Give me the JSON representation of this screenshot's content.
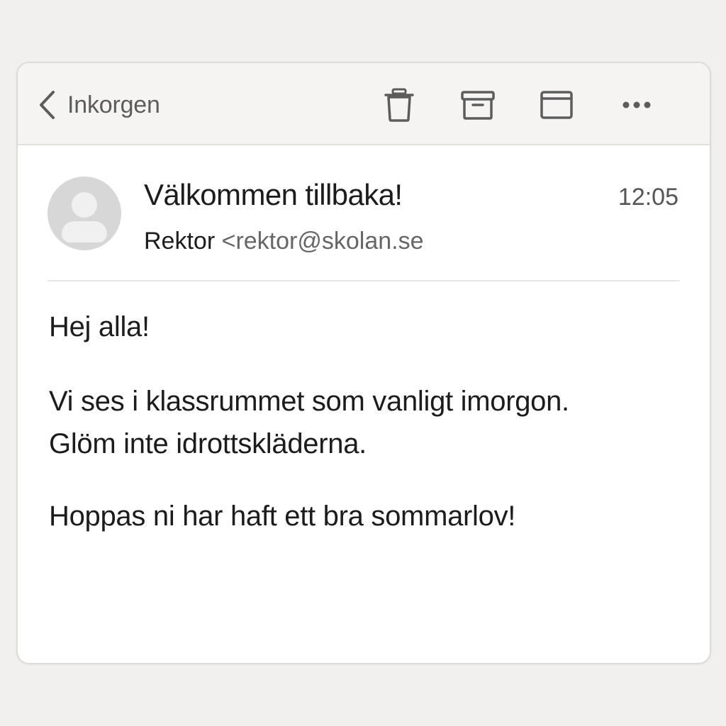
{
  "toolbar": {
    "back_label": "Inkorgen",
    "back_icon": "chevron-left-icon",
    "actions": [
      {
        "name": "trash-button",
        "icon": "trash-icon"
      },
      {
        "name": "archive-button",
        "icon": "archive-icon"
      },
      {
        "name": "move-button",
        "icon": "folder-window-icon"
      },
      {
        "name": "more-button",
        "icon": "ellipsis-icon"
      }
    ]
  },
  "message": {
    "subject": "Välkommen tillbaka!",
    "time": "12:05",
    "sender_name": "Rektor",
    "sender_email": "<rektor@skolan.se",
    "greeting": "Hej alla!",
    "paragraph1_line1": "Vi ses i klassrummet som vanligt imorgon.",
    "paragraph1_line2": "Glöm inte idrottskläderna.",
    "paragraph2": "Hoppas ni har haft ett bra sommarlov!"
  },
  "colors": {
    "background": "#f1f0ee",
    "toolbar": "#f5f4f2",
    "icon": "#5c5c5c",
    "text": "#1c1c1c",
    "secondary_text": "#666666",
    "avatar": "#d7d7d7"
  }
}
